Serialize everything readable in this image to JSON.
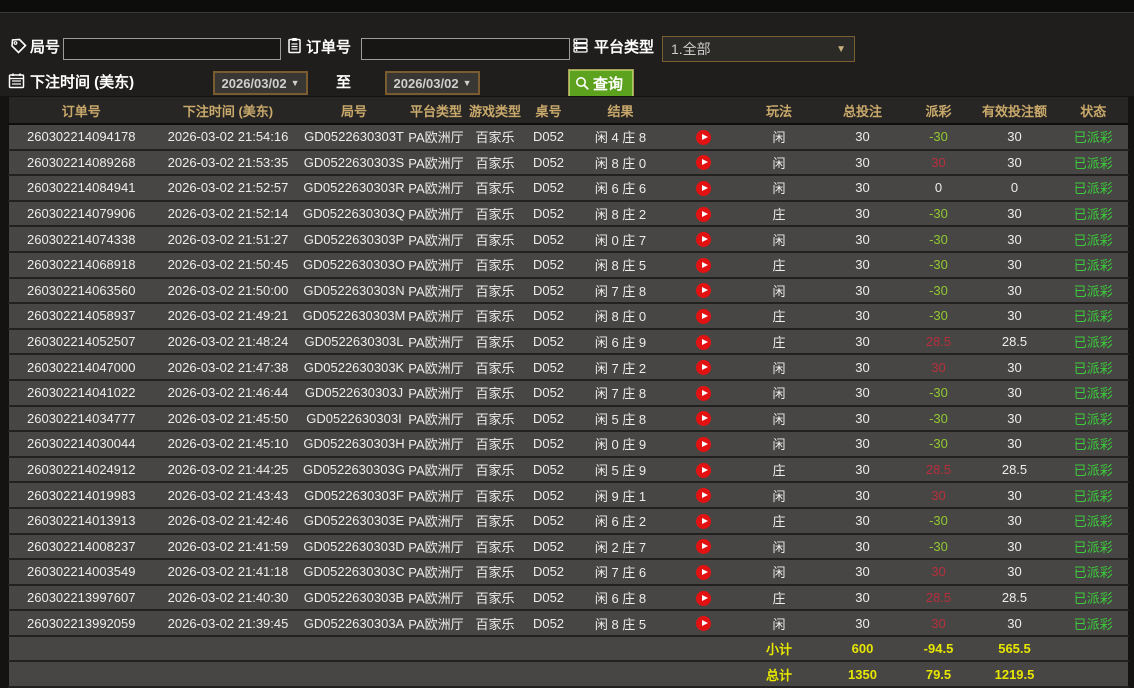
{
  "filters": {
    "round_label": "局号",
    "round_value": "",
    "order_label": "订单号",
    "order_value": "",
    "platform_label": "平台类型",
    "platform_selected": "1.全部",
    "time_label": "下注时间 (美东)",
    "date_from": "2026/03/02",
    "to_label": "至",
    "date_to": "2026/03/02",
    "search_label": "查询"
  },
  "colors": {
    "accent_green_button": "#5da21e",
    "header_text": "#c9a96b",
    "payout_negative": "#8fc832",
    "payout_positive": "#b5303d",
    "status_green": "#3ccb3c",
    "summary_yellow": "#e6e600",
    "row_background": "#484644"
  },
  "table": {
    "headers": [
      "订单号",
      "下注时间 (美东)",
      "局号",
      "平台类型",
      "游戏类型",
      "桌号",
      "结果",
      "",
      "玩法",
      "总投注",
      "派彩",
      "有效投注额",
      "状态"
    ],
    "rows": [
      {
        "order": "260302214094178",
        "time": "2026-03-02 21:54:16",
        "round": "GD0522630303T",
        "platform": "PA欧洲厅",
        "game": "百家乐",
        "table_no": "D052",
        "result": "闲 4 庄 8",
        "play": "闲",
        "total": "30",
        "payout": "-30",
        "payout_state": "neg",
        "valid": "30",
        "status": "已派彩"
      },
      {
        "order": "260302214089268",
        "time": "2026-03-02 21:53:35",
        "round": "GD0522630303S",
        "platform": "PA欧洲厅",
        "game": "百家乐",
        "table_no": "D052",
        "result": "闲 8 庄 0",
        "play": "闲",
        "total": "30",
        "payout": "30",
        "payout_state": "pos",
        "valid": "30",
        "status": "已派彩"
      },
      {
        "order": "260302214084941",
        "time": "2026-03-02 21:52:57",
        "round": "GD0522630303R",
        "platform": "PA欧洲厅",
        "game": "百家乐",
        "table_no": "D052",
        "result": "闲 6 庄 6",
        "play": "闲",
        "total": "30",
        "payout": "0",
        "payout_state": "zero",
        "valid": "0",
        "status": "已派彩"
      },
      {
        "order": "260302214079906",
        "time": "2026-03-02 21:52:14",
        "round": "GD0522630303Q",
        "platform": "PA欧洲厅",
        "game": "百家乐",
        "table_no": "D052",
        "result": "闲 8 庄 2",
        "play": "庄",
        "total": "30",
        "payout": "-30",
        "payout_state": "neg",
        "valid": "30",
        "status": "已派彩"
      },
      {
        "order": "260302214074338",
        "time": "2026-03-02 21:51:27",
        "round": "GD0522630303P",
        "platform": "PA欧洲厅",
        "game": "百家乐",
        "table_no": "D052",
        "result": "闲 0 庄 7",
        "play": "闲",
        "total": "30",
        "payout": "-30",
        "payout_state": "neg",
        "valid": "30",
        "status": "已派彩"
      },
      {
        "order": "260302214068918",
        "time": "2026-03-02 21:50:45",
        "round": "GD0522630303O",
        "platform": "PA欧洲厅",
        "game": "百家乐",
        "table_no": "D052",
        "result": "闲 8 庄 5",
        "play": "庄",
        "total": "30",
        "payout": "-30",
        "payout_state": "neg",
        "valid": "30",
        "status": "已派彩"
      },
      {
        "order": "260302214063560",
        "time": "2026-03-02 21:50:00",
        "round": "GD0522630303N",
        "platform": "PA欧洲厅",
        "game": "百家乐",
        "table_no": "D052",
        "result": "闲 7 庄 8",
        "play": "闲",
        "total": "30",
        "payout": "-30",
        "payout_state": "neg",
        "valid": "30",
        "status": "已派彩"
      },
      {
        "order": "260302214058937",
        "time": "2026-03-02 21:49:21",
        "round": "GD0522630303M",
        "platform": "PA欧洲厅",
        "game": "百家乐",
        "table_no": "D052",
        "result": "闲 8 庄 0",
        "play": "庄",
        "total": "30",
        "payout": "-30",
        "payout_state": "neg",
        "valid": "30",
        "status": "已派彩"
      },
      {
        "order": "260302214052507",
        "time": "2026-03-02 21:48:24",
        "round": "GD0522630303L",
        "platform": "PA欧洲厅",
        "game": "百家乐",
        "table_no": "D052",
        "result": "闲 6 庄 9",
        "play": "庄",
        "total": "30",
        "payout": "28.5",
        "payout_state": "pos",
        "valid": "28.5",
        "status": "已派彩"
      },
      {
        "order": "260302214047000",
        "time": "2026-03-02 21:47:38",
        "round": "GD0522630303K",
        "platform": "PA欧洲厅",
        "game": "百家乐",
        "table_no": "D052",
        "result": "闲 7 庄 2",
        "play": "闲",
        "total": "30",
        "payout": "30",
        "payout_state": "pos",
        "valid": "30",
        "status": "已派彩"
      },
      {
        "order": "260302214041022",
        "time": "2026-03-02 21:46:44",
        "round": "GD0522630303J",
        "platform": "PA欧洲厅",
        "game": "百家乐",
        "table_no": "D052",
        "result": "闲 7 庄 8",
        "play": "闲",
        "total": "30",
        "payout": "-30",
        "payout_state": "neg",
        "valid": "30",
        "status": "已派彩"
      },
      {
        "order": "260302214034777",
        "time": "2026-03-02 21:45:50",
        "round": "GD0522630303I",
        "platform": "PA欧洲厅",
        "game": "百家乐",
        "table_no": "D052",
        "result": "闲 5 庄 8",
        "play": "闲",
        "total": "30",
        "payout": "-30",
        "payout_state": "neg",
        "valid": "30",
        "status": "已派彩"
      },
      {
        "order": "260302214030044",
        "time": "2026-03-02 21:45:10",
        "round": "GD0522630303H",
        "platform": "PA欧洲厅",
        "game": "百家乐",
        "table_no": "D052",
        "result": "闲 0 庄 9",
        "play": "闲",
        "total": "30",
        "payout": "-30",
        "payout_state": "neg",
        "valid": "30",
        "status": "已派彩"
      },
      {
        "order": "260302214024912",
        "time": "2026-03-02 21:44:25",
        "round": "GD0522630303G",
        "platform": "PA欧洲厅",
        "game": "百家乐",
        "table_no": "D052",
        "result": "闲 5 庄 9",
        "play": "庄",
        "total": "30",
        "payout": "28.5",
        "payout_state": "pos",
        "valid": "28.5",
        "status": "已派彩"
      },
      {
        "order": "260302214019983",
        "time": "2026-03-02 21:43:43",
        "round": "GD0522630303F",
        "platform": "PA欧洲厅",
        "game": "百家乐",
        "table_no": "D052",
        "result": "闲 9 庄 1",
        "play": "闲",
        "total": "30",
        "payout": "30",
        "payout_state": "pos",
        "valid": "30",
        "status": "已派彩"
      },
      {
        "order": "260302214013913",
        "time": "2026-03-02 21:42:46",
        "round": "GD0522630303E",
        "platform": "PA欧洲厅",
        "game": "百家乐",
        "table_no": "D052",
        "result": "闲 6 庄 2",
        "play": "庄",
        "total": "30",
        "payout": "-30",
        "payout_state": "neg",
        "valid": "30",
        "status": "已派彩"
      },
      {
        "order": "260302214008237",
        "time": "2026-03-02 21:41:59",
        "round": "GD0522630303D",
        "platform": "PA欧洲厅",
        "game": "百家乐",
        "table_no": "D052",
        "result": "闲 2 庄 7",
        "play": "闲",
        "total": "30",
        "payout": "-30",
        "payout_state": "neg",
        "valid": "30",
        "status": "已派彩"
      },
      {
        "order": "260302214003549",
        "time": "2026-03-02 21:41:18",
        "round": "GD0522630303C",
        "platform": "PA欧洲厅",
        "game": "百家乐",
        "table_no": "D052",
        "result": "闲 7 庄 6",
        "play": "闲",
        "total": "30",
        "payout": "30",
        "payout_state": "pos",
        "valid": "30",
        "status": "已派彩"
      },
      {
        "order": "260302213997607",
        "time": "2026-03-02 21:40:30",
        "round": "GD0522630303B",
        "platform": "PA欧洲厅",
        "game": "百家乐",
        "table_no": "D052",
        "result": "闲 6 庄 8",
        "play": "庄",
        "total": "30",
        "payout": "28.5",
        "payout_state": "pos",
        "valid": "28.5",
        "status": "已派彩"
      },
      {
        "order": "260302213992059",
        "time": "2026-03-02 21:39:45",
        "round": "GD0522630303A",
        "platform": "PA欧洲厅",
        "game": "百家乐",
        "table_no": "D052",
        "result": "闲 8 庄 5",
        "play": "闲",
        "total": "30",
        "payout": "30",
        "payout_state": "pos",
        "valid": "30",
        "status": "已派彩"
      }
    ],
    "subtotal": {
      "label": "小计",
      "total": "600",
      "payout": "-94.5",
      "valid": "565.5"
    },
    "grand_total": {
      "label": "总计",
      "total": "1350",
      "payout": "79.5",
      "valid": "1219.5"
    }
  }
}
